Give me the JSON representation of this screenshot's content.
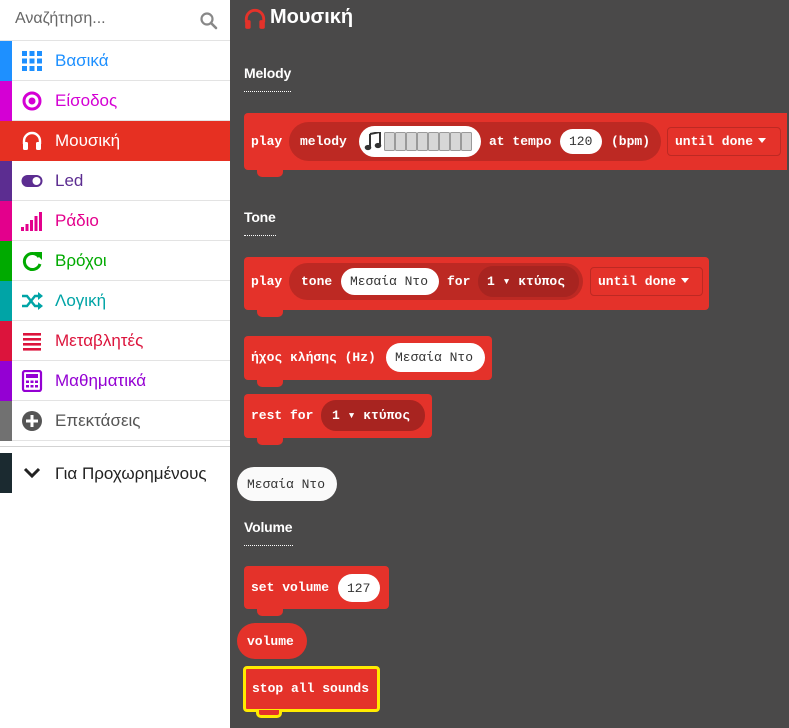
{
  "search": {
    "placeholder": "Αναζήτηση..."
  },
  "categories": [
    {
      "label": "Βασικά",
      "color": "#1e90ff",
      "icon": "grid-icon"
    },
    {
      "label": "Είσοδος",
      "color": "#d400d4",
      "icon": "input-circle-icon"
    },
    {
      "label": "Μουσική",
      "color": "#e63022",
      "icon": "headphones-icon",
      "selected": true
    },
    {
      "label": "Led",
      "color": "#5c2d91",
      "icon": "toggle-icon"
    },
    {
      "label": "Ράδιο",
      "color": "#e3008c",
      "icon": "signal-bars-icon"
    },
    {
      "label": "Βρόχοι",
      "color": "#00aa00",
      "icon": "refresh-icon"
    },
    {
      "label": "Λογική",
      "color": "#00a4a6",
      "icon": "shuffle-icon"
    },
    {
      "label": "Μεταβλητές",
      "color": "#dc143c",
      "icon": "lines-icon"
    },
    {
      "label": "Μαθηματικά",
      "color": "#9400d3",
      "icon": "calculator-icon"
    },
    {
      "label": "Επεκτάσεις",
      "color": "#717171",
      "icon": "plus-circle-icon"
    }
  ],
  "advanced": {
    "label": "Για Προχωρημένους",
    "icon": "chevron-down-icon"
  },
  "flyout": {
    "title": "Μουσική",
    "sections": {
      "melody": "Melody",
      "tone": "Tone",
      "volume": "Volume"
    },
    "blocks": {
      "play_melody": {
        "play": "play",
        "melody": "melody",
        "at_tempo": "at tempo",
        "tempo": "120",
        "bpm": "(bpm)",
        "mode": "until done"
      },
      "play_tone": {
        "play": "play",
        "tone": "tone",
        "note": "Μεσαία Ντο",
        "for": "for",
        "beat": "1 ▾ κτύπος",
        "mode": "until done"
      },
      "ring_tone": {
        "label": "ήχος κλήσης (Hz)",
        "note": "Μεσαία Ντο"
      },
      "rest": {
        "label": "rest for",
        "beat": "1 ▾ κτύπος"
      },
      "note_value": {
        "note": "Μεσαία Ντο"
      },
      "set_volume": {
        "label": "set volume",
        "value": "127"
      },
      "volume": {
        "label": "volume"
      },
      "stop_sounds": {
        "label": "stop all sounds"
      }
    }
  },
  "colors": {
    "music": "#e4322a",
    "music_dark": "#bd2923",
    "workspace": "#4a4949",
    "highlight": "#ffeb00"
  }
}
